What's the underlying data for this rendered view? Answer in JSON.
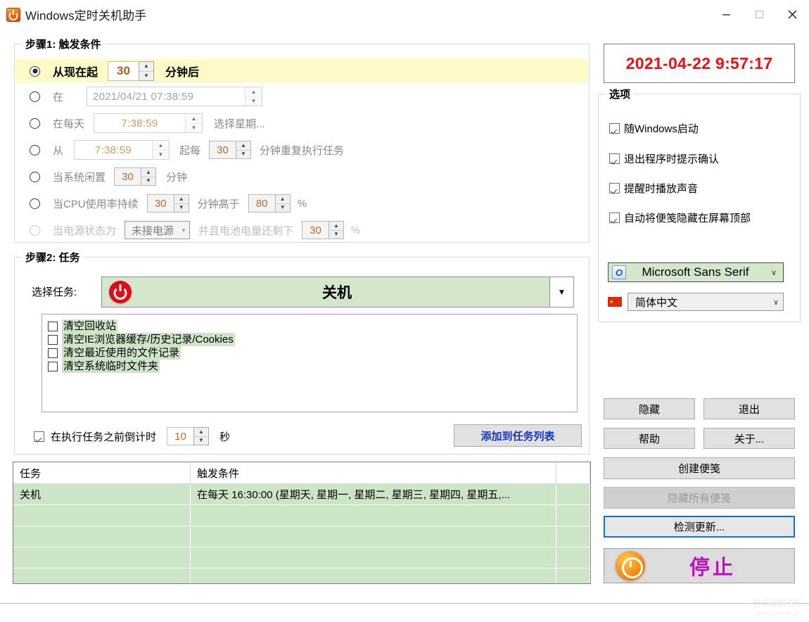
{
  "window": {
    "title": "Windows定时关机助手",
    "icon": "power-app-icon",
    "controls": {
      "minimize": "—",
      "maximize": "□",
      "close": "✕"
    }
  },
  "step1": {
    "legend": "步骤1: 触发条件",
    "options": [
      {
        "label": "从现在起",
        "value": "30",
        "suffix": "分钟后",
        "selected": true
      },
      {
        "label": "在",
        "value": "2021/04/21  07:38:59",
        "selected": false
      },
      {
        "label": "在每天",
        "value": "7:38:59",
        "link": "选择星期...",
        "selected": false
      },
      {
        "label": "从",
        "value": "7:38:59",
        "mid": "起每",
        "value2": "30",
        "suffix": "分钟重复执行任务",
        "selected": false
      },
      {
        "label": "当系统闲置",
        "value": "30",
        "suffix": "分钟",
        "selected": false
      },
      {
        "label": "当CPU使用率持续",
        "value": "30",
        "mid": "分钟高于",
        "value2": "80",
        "suffix": "%",
        "selected": false
      },
      {
        "label": "当电源状态为",
        "dropdown": "未接电源",
        "mid": "并且电池电量还剩下",
        "value2": "30",
        "suffix": "%",
        "selected": false
      }
    ]
  },
  "step2": {
    "legend": "步骤2: 任务",
    "select_task_label": "选择任务:",
    "task_name": "关机",
    "task_icon": "power-icon",
    "checklist": [
      {
        "label": "清空回收站",
        "checked": false
      },
      {
        "label": "清空IE浏览器缓存/历史记录/Cookies",
        "checked": false
      },
      {
        "label": "清空最近使用的文件记录",
        "checked": false
      },
      {
        "label": "清空系统临时文件夹",
        "checked": false
      }
    ],
    "countdown": {
      "label": "在执行任务之前倒计时",
      "value": "10",
      "unit": "秒",
      "checked": true
    },
    "add_button": "添加到任务列表"
  },
  "task_table": {
    "headers": [
      "任务",
      "触发条件",
      ""
    ],
    "rows": [
      [
        "关机",
        "在每天 16:30:00 (星期天, 星期一, 星期二, 星期三, 星期四, 星期五,...",
        ""
      ],
      [
        "",
        "",
        ""
      ],
      [
        "",
        "",
        ""
      ],
      [
        "",
        "",
        ""
      ],
      [
        "",
        "",
        ""
      ]
    ]
  },
  "right": {
    "clock": "2021-04-22 9:57:17",
    "options_legend": "选项",
    "options": [
      {
        "label": "随Windows启动",
        "checked": true
      },
      {
        "label": "退出程序时提示确认",
        "checked": true
      },
      {
        "label": "提醒时播放声音",
        "checked": true
      },
      {
        "label": "自动将便笺隐藏在屏幕顶部",
        "checked": true
      }
    ],
    "font_select": {
      "value": "Microsoft Sans Serif",
      "icon": "font-o-icon"
    },
    "language_select": {
      "value": "简体中文",
      "icon": "china-flag-icon"
    },
    "buttons": {
      "hide": "隐藏",
      "exit": "退出",
      "help": "帮助",
      "about": "关于...",
      "create_note": "创建便笺",
      "hide_all_notes": "隐藏所有便笺",
      "check_update": "检测更新..."
    },
    "stop_button": {
      "label": "停止",
      "icon": "clock-icon"
    }
  },
  "watermark": {
    "line1": "吾爱破解论坛",
    "line2": "www.52pojie.cn"
  },
  "colors": {
    "highlight_row": "#fcfbc8",
    "green_panel": "#cde4c6",
    "clock_red": "#f10d0d",
    "stop_magenta": "#c50cc5",
    "add_blue": "#1435c4"
  }
}
